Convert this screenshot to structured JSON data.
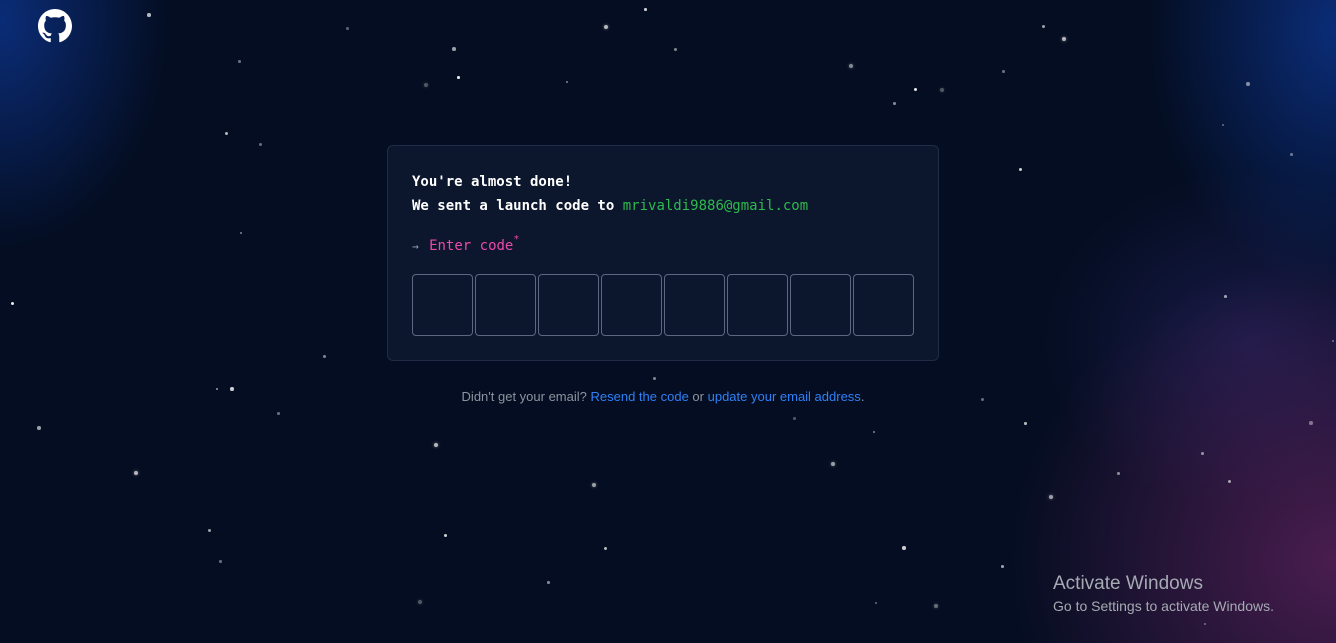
{
  "brand": {
    "logo_icon": "github-icon"
  },
  "card": {
    "line1": "You're almost done!",
    "line2_prefix": "We sent a launch code to",
    "email": "mrivaldi9886@gmail.com",
    "arrow": "→",
    "code_label": "Enter code",
    "required_mark": "*",
    "code_digits": [
      "",
      "",
      "",
      "",
      "",
      "",
      "",
      ""
    ]
  },
  "footer": {
    "prefix": "Didn't get your email?",
    "resend_link": "Resend the code",
    "middle": "or",
    "update_link": "update your email address",
    "suffix": "."
  },
  "watermark": {
    "title": "Activate Windows",
    "subtitle": "Go to Settings to activate Windows."
  },
  "colors": {
    "background": "#040d21",
    "email_green": "#2dba4e",
    "label_pink": "#ea4aaa",
    "link_blue": "#2f81f7"
  }
}
